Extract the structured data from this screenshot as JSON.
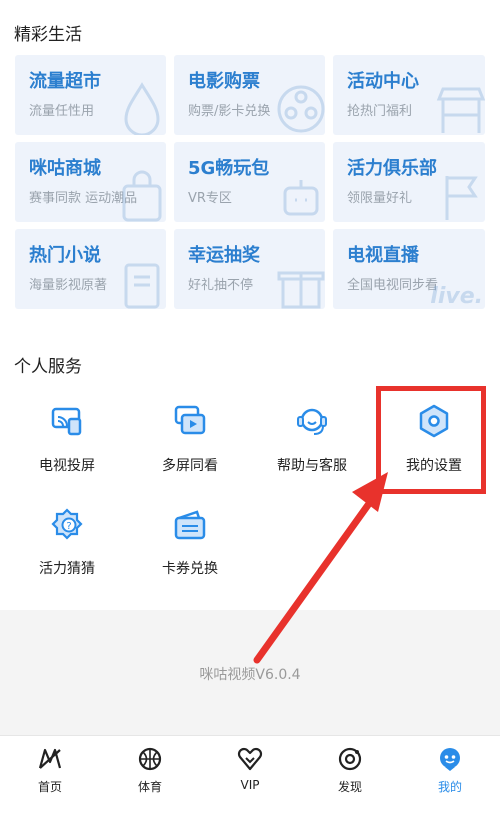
{
  "sections": {
    "life_title": "精彩生活",
    "service_title": "个人服务"
  },
  "life_tiles": [
    {
      "title": "流量超市",
      "subtitle": "流量任性用",
      "icon": "drop-icon"
    },
    {
      "title": "电影购票",
      "subtitle": "购票/影卡兑换",
      "icon": "film-reel-icon"
    },
    {
      "title": "活动中心",
      "subtitle": "抢热门福利",
      "icon": "stall-icon"
    },
    {
      "title": "咪咕商城",
      "subtitle": "赛事同款 运动潮品",
      "icon": "bag-icon"
    },
    {
      "title": "5G畅玩包",
      "subtitle": "VR专区",
      "icon": "robot-icon"
    },
    {
      "title": "活力俱乐部",
      "subtitle": "领限量好礼",
      "icon": "flag-icon"
    },
    {
      "title": "热门小说",
      "subtitle": "海量影视原著",
      "icon": "book-icon"
    },
    {
      "title": "幸运抽奖",
      "subtitle": "好礼抽不停",
      "icon": "gift-icon"
    },
    {
      "title": "电视直播",
      "subtitle": "全国电视同步看",
      "icon": "live-icon",
      "deco_text": "live."
    }
  ],
  "services": [
    {
      "label": "电视投屏",
      "icon": "tv-cast-icon"
    },
    {
      "label": "多屏同看",
      "icon": "multi-screen-icon"
    },
    {
      "label": "帮助与客服",
      "icon": "headset-icon"
    },
    {
      "label": "我的设置",
      "icon": "settings-hexagon-icon"
    },
    {
      "label": "活力猜猜",
      "icon": "quiz-icon"
    },
    {
      "label": "卡券兑换",
      "icon": "coupon-wallet-icon"
    }
  ],
  "version": "咪咕视频V6.0.4",
  "tabs": [
    {
      "label": "首页",
      "icon": "home-icon",
      "active": false
    },
    {
      "label": "体育",
      "icon": "basketball-icon",
      "active": false
    },
    {
      "label": "VIP",
      "icon": "vip-heart-icon",
      "active": false
    },
    {
      "label": "发现",
      "icon": "discover-icon",
      "active": false
    },
    {
      "label": "我的",
      "icon": "mine-icon",
      "active": true
    }
  ],
  "colors": {
    "accent": "#2a8ce8",
    "tile_title": "#2c7fcf",
    "tile_bg": "#eef3fb",
    "annotation_red": "#e8322c"
  }
}
